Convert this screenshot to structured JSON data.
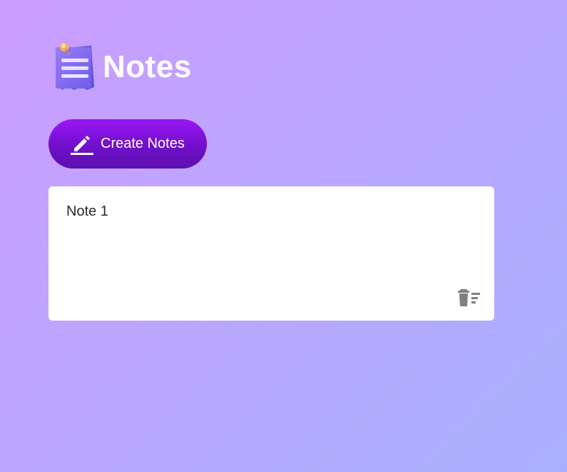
{
  "app": {
    "title": "Notes"
  },
  "toolbar": {
    "create_label": "Create Notes",
    "create_icon": "edit-icon"
  },
  "notes": [
    {
      "text": "Note 1",
      "delete_icon": "delete-icon"
    }
  ],
  "colors": {
    "background_start": "#cc9dff",
    "background_end": "#aab0ff",
    "button_top": "#9a17f5",
    "button_bottom": "#5d0fb0",
    "card": "#ffffff",
    "delete_icon": "#808080"
  }
}
